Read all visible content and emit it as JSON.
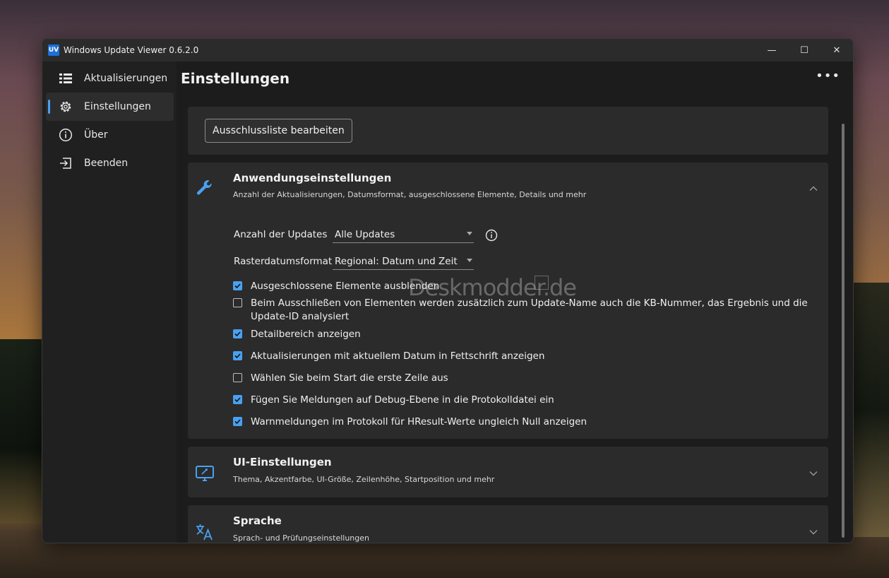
{
  "window": {
    "logo_text": "UV",
    "title": "Windows Update Viewer  0.6.2.0",
    "min_glyph": "—",
    "max_glyph": "☐",
    "close_glyph": "✕"
  },
  "sidebar": {
    "items": [
      {
        "label": "Aktualisierungen",
        "icon": "list-icon"
      },
      {
        "label": "Einstellungen",
        "icon": "gear-icon",
        "active": true
      },
      {
        "label": "Über",
        "icon": "info-icon"
      },
      {
        "label": "Beenden",
        "icon": "exit-icon"
      }
    ]
  },
  "header": {
    "title": "Einstellungen",
    "more": "•••"
  },
  "exclusion_button": "Ausschlussliste bearbeiten",
  "app_settings": {
    "title": "Anwendungseinstellungen",
    "subtitle": "Anzahl der Aktualisierungen, Datumsformat, ausgeschlossene Elemente, Details und mehr",
    "update_count_label": "Anzahl der Updates",
    "update_count_value": "Alle Updates",
    "date_format_label": "Rasterdatumsformat",
    "date_format_value": "Regional: Datum und Zeit",
    "checkboxes": [
      {
        "label": "Ausgeschlossene Elemente ausblenden",
        "checked": true
      },
      {
        "label": "Beim Ausschließen von Elementen werden zusätzlich zum Update-Name auch die KB-Nummer, das Ergebnis und die Update-ID analysiert",
        "checked": false
      },
      {
        "label": "Detailbereich anzeigen",
        "checked": true
      },
      {
        "label": "Aktualisierungen mit aktuellem Datum in Fettschrift anzeigen",
        "checked": true
      },
      {
        "label": "Wählen Sie beim Start die erste Zeile aus",
        "checked": false
      },
      {
        "label": "Fügen Sie Meldungen auf Debug-Ebene in die Protokolldatei ein",
        "checked": true
      },
      {
        "label": "Warnmeldungen im Protokoll für HResult-Werte ungleich Null anzeigen",
        "checked": true
      }
    ]
  },
  "ui_settings": {
    "title": "UI-Einstellungen",
    "subtitle": "Thema, Akzentfarbe, UI-Größe, Zeilenhöhe, Startposition und mehr"
  },
  "language": {
    "title": "Sprache",
    "subtitle": "Sprach- und Prüfungseinstellungen"
  },
  "watermark": "Deskmodder.de",
  "colors": {
    "accent": "#4aa0f0",
    "card": "#2b2b2b",
    "background": "#1c1c1c"
  }
}
